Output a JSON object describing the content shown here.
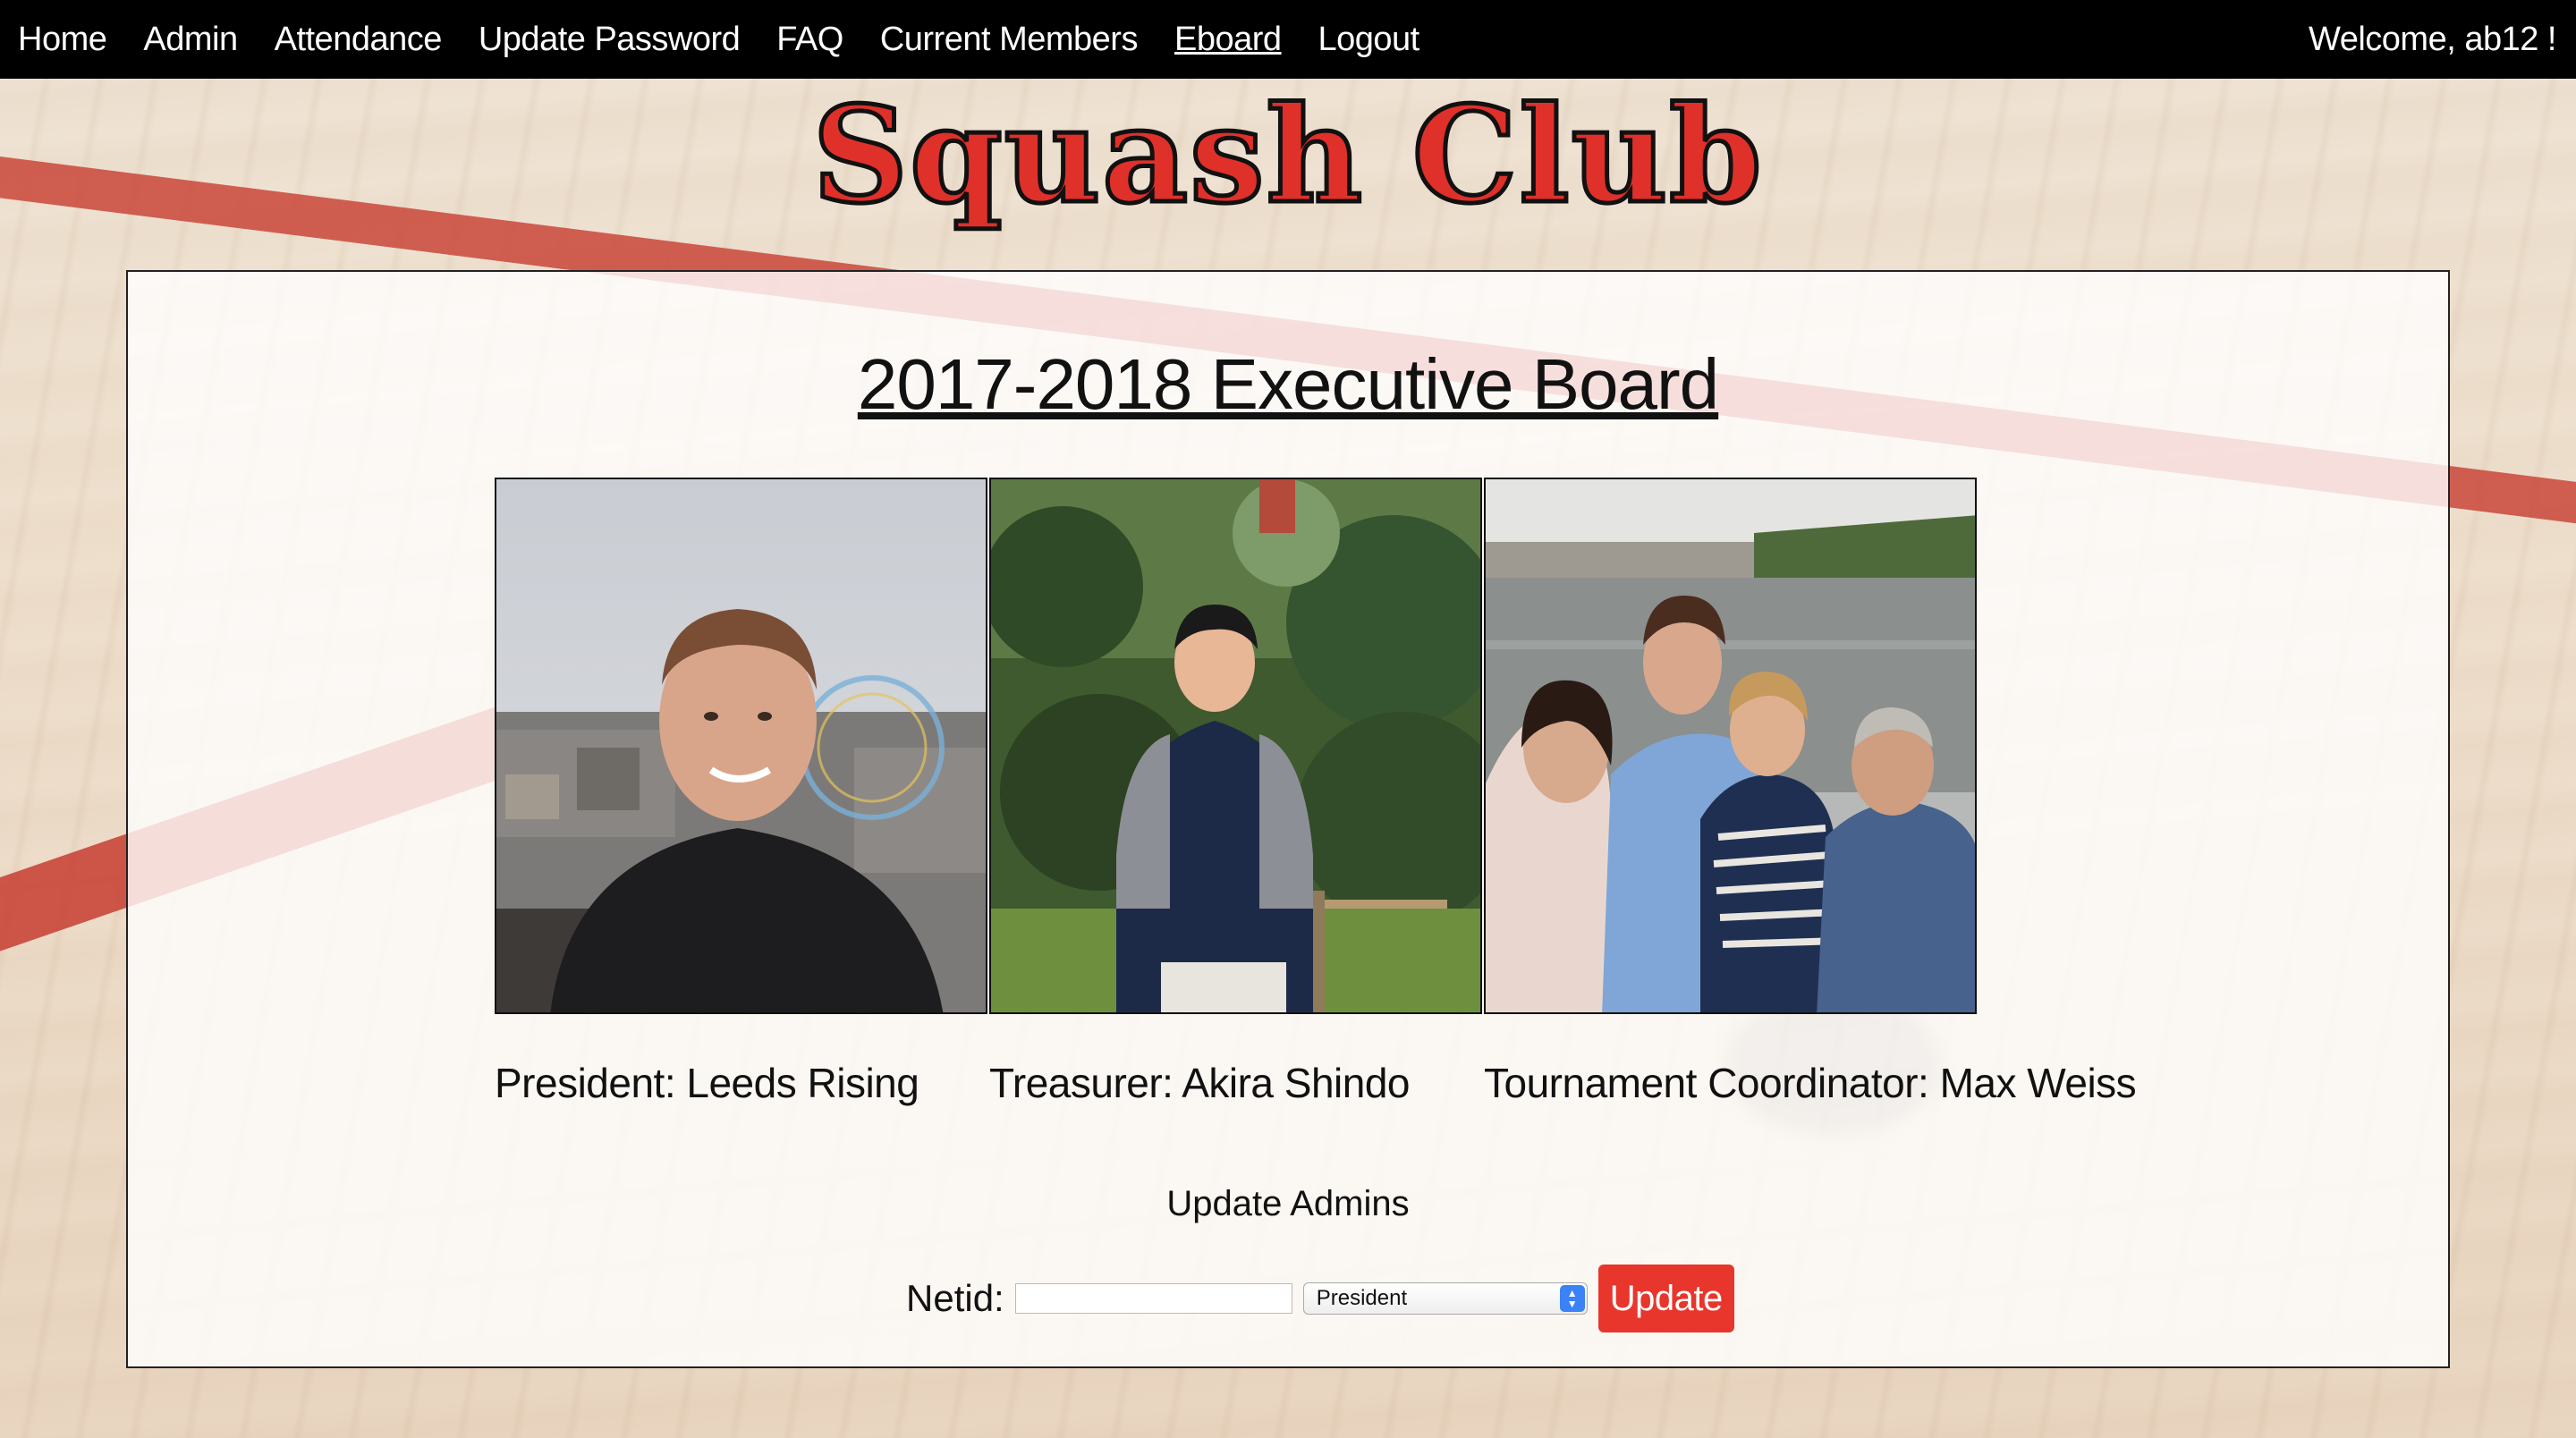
{
  "nav": {
    "items": [
      {
        "label": "Home"
      },
      {
        "label": "Admin"
      },
      {
        "label": "Attendance"
      },
      {
        "label": "Update Password"
      },
      {
        "label": "FAQ"
      },
      {
        "label": "Current Members"
      },
      {
        "label": "Eboard",
        "active": true
      },
      {
        "label": "Logout"
      }
    ],
    "welcome": "Welcome, ab12 !"
  },
  "header": {
    "title": "Squash Club"
  },
  "board": {
    "title": "2017-2018 Executive Board",
    "members": [
      {
        "caption": "President: Leeds Rising"
      },
      {
        "caption": "Treasurer: Akira Shindo"
      },
      {
        "caption": "Tournament Coordinator: Max Weiss"
      }
    ]
  },
  "admin_form": {
    "title": "Update Admins",
    "netid_label": "Netid:",
    "netid_value": "",
    "role_selected": "President",
    "submit_label": "Update"
  },
  "colors": {
    "nav_bg": "#000000",
    "title_red": "#e0302a",
    "button_red": "#e8362c",
    "court_line": "#c9463a"
  }
}
